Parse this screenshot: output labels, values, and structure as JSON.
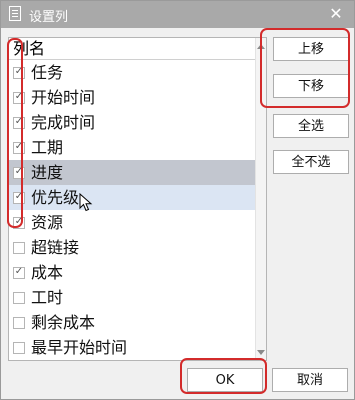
{
  "window": {
    "title": "设置列",
    "close_glyph": "✕"
  },
  "list": {
    "header": "列名",
    "rows": [
      {
        "label": "任务",
        "checked": true,
        "state": "normal"
      },
      {
        "label": "开始时间",
        "checked": true,
        "state": "normal"
      },
      {
        "label": "完成时间",
        "checked": true,
        "state": "normal"
      },
      {
        "label": "工期",
        "checked": true,
        "state": "normal"
      },
      {
        "label": "进度",
        "checked": true,
        "state": "selected"
      },
      {
        "label": "优先级",
        "checked": true,
        "state": "hover"
      },
      {
        "label": "资源",
        "checked": true,
        "state": "normal"
      },
      {
        "label": "超链接",
        "checked": false,
        "state": "normal"
      },
      {
        "label": "成本",
        "checked": true,
        "state": "normal"
      },
      {
        "label": "工时",
        "checked": false,
        "state": "normal"
      },
      {
        "label": "剩余成本",
        "checked": false,
        "state": "normal"
      },
      {
        "label": "最早开始时间",
        "checked": false,
        "state": "normal"
      }
    ]
  },
  "buttons": {
    "move_up": "上移",
    "move_down": "下移",
    "select_all": "全选",
    "deselect_all": "全不选",
    "ok": "OK",
    "cancel": "取消"
  },
  "colors": {
    "annotation": "#d32b2b",
    "titlebar": "#a9a9a9",
    "selected_row": "#c2c6cf",
    "hover_row": "#dbe5f3"
  }
}
